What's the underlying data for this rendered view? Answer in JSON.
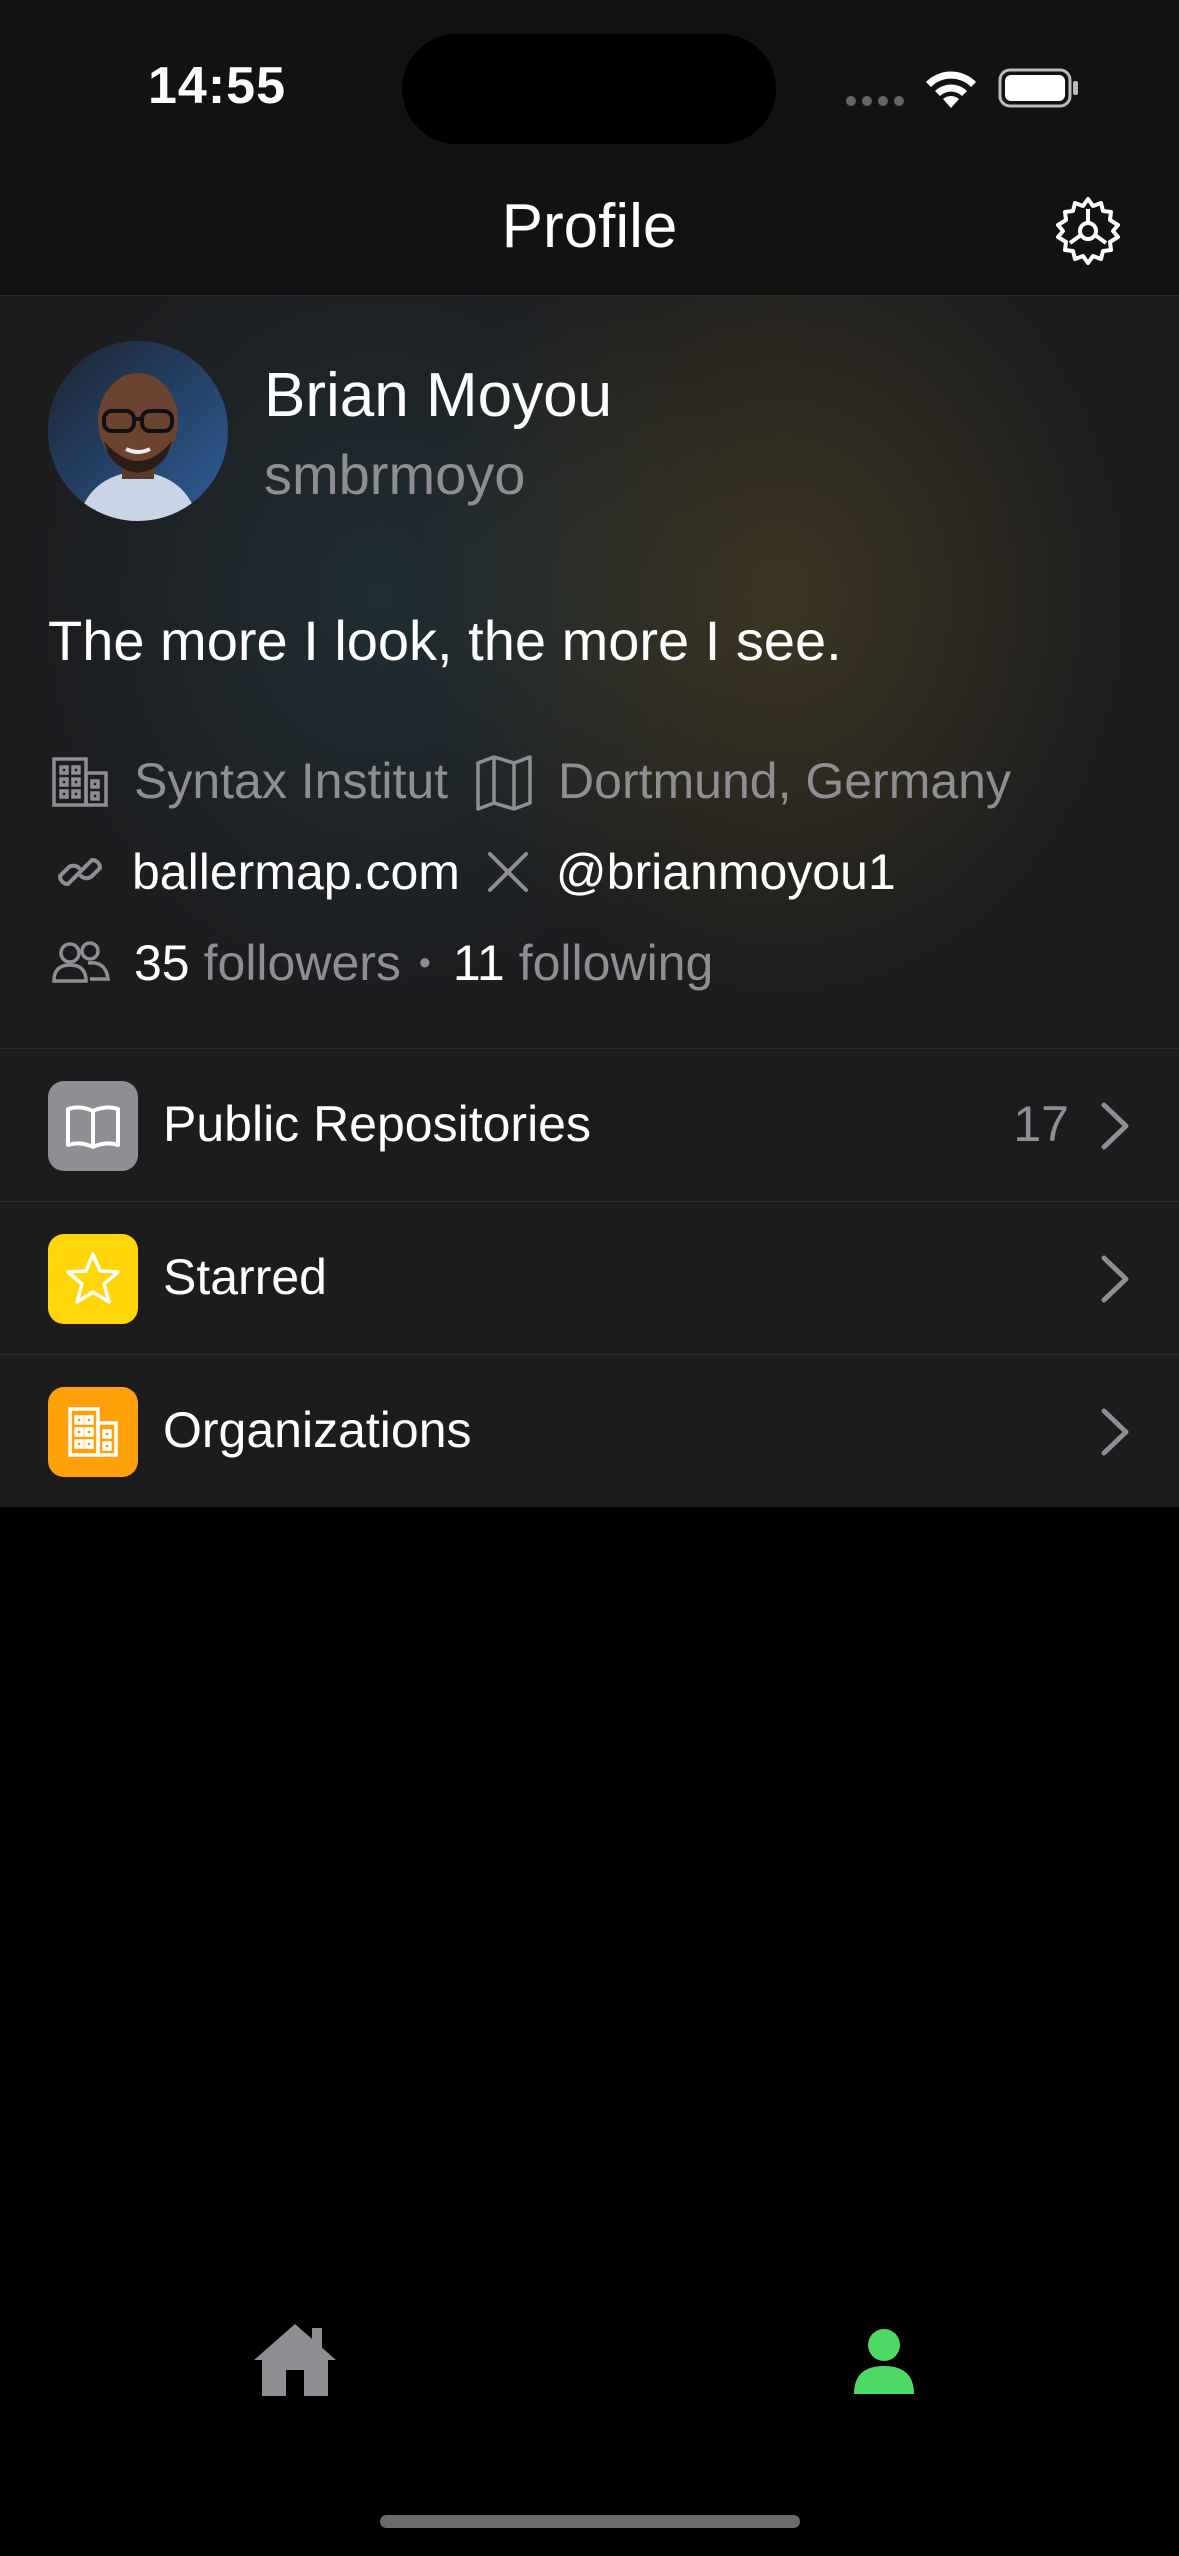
{
  "status_bar": {
    "time": "14:55"
  },
  "nav": {
    "title": "Profile",
    "settings_icon": "gear-icon"
  },
  "profile": {
    "name": "Brian Moyou",
    "username": "smbrmoyo",
    "bio": "The more I look, the more I see.",
    "company": "Syntax Institut",
    "location": "Dortmund, Germany",
    "website": "ballermap.com",
    "x_handle": "@brianmoyou1",
    "followers_count": "35",
    "followers_label": "followers",
    "separator": "•",
    "following_count": "11",
    "following_label": "following"
  },
  "list": {
    "items": [
      {
        "label": "Public Repositories",
        "count": "17",
        "icon": "book-icon",
        "color": "#8e8e93"
      },
      {
        "label": "Starred",
        "count": "",
        "icon": "star-icon",
        "color": "#ffd60a"
      },
      {
        "label": "Organizations",
        "count": "",
        "icon": "building-icon",
        "color": "#ff9f0a"
      }
    ]
  },
  "tab_bar": {
    "tabs": [
      {
        "icon": "house-icon",
        "active": false
      },
      {
        "icon": "person-icon",
        "active": true,
        "color": "#4cd964"
      }
    ]
  }
}
